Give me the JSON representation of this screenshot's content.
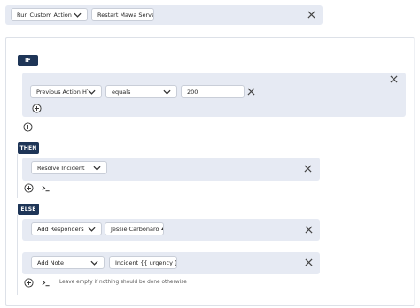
{
  "top": {
    "action_select": "Run Custom Action",
    "target_select": "Restart Mawa Server"
  },
  "if_block": {
    "tag": "IF",
    "condition": {
      "field": "Previous Action HTTP",
      "operator": "equals",
      "value": "200"
    }
  },
  "then_block": {
    "tag": "THEN",
    "action": "Resolve Incident"
  },
  "else_block": {
    "tag": "ELSE",
    "actions": [
      {
        "action": "Add Responders",
        "value": "Jessie Carbonaro"
      },
      {
        "action": "Add Note",
        "value": "Incident {{ urgency }}"
      }
    ],
    "hint": "Leave empty if nothing should be done otherwise"
  },
  "icons": {
    "close": "close-icon",
    "add": "plus-circle-icon",
    "script": "terminal-icon",
    "chevron": "chevron-down-icon",
    "caret": "caret-up-icon"
  },
  "colors": {
    "panel": "#e6eaf3",
    "tag": "#1e3557",
    "border": "#c9ced8"
  }
}
